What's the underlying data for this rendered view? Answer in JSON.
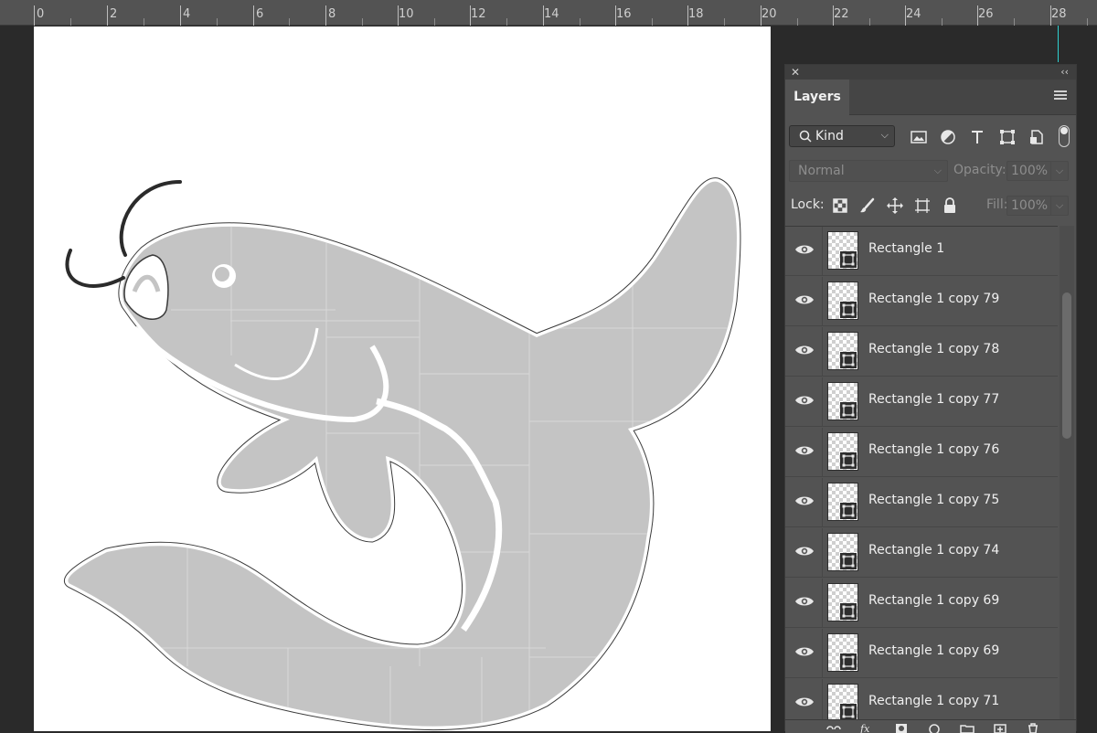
{
  "ruler": {
    "labels": [
      "0",
      "2",
      "4",
      "6",
      "8",
      "10",
      "12",
      "14",
      "16",
      "18",
      "20",
      "22",
      "24",
      "26",
      "28"
    ]
  },
  "layers_panel": {
    "tab_label": "Layers",
    "filter": {
      "kind_label": "Kind"
    },
    "blend_mode": "Normal",
    "opacity_label": "Opacity:",
    "opacity_value": "100%",
    "lock_label": "Lock:",
    "fill_label": "Fill:",
    "fill_value": "100%",
    "layers": [
      {
        "name": "Rectangle 1",
        "visible": true
      },
      {
        "name": "Rectangle 1 copy 79",
        "visible": true
      },
      {
        "name": "Rectangle 1 copy 78",
        "visible": true
      },
      {
        "name": "Rectangle 1 copy 77",
        "visible": true
      },
      {
        "name": "Rectangle 1 copy 76",
        "visible": true
      },
      {
        "name": "Rectangle 1 copy 75",
        "visible": true
      },
      {
        "name": "Rectangle 1 copy 74",
        "visible": true
      },
      {
        "name": "Rectangle 1 copy 69",
        "visible": true
      },
      {
        "name": "Rectangle 1 copy 69",
        "visible": true
      },
      {
        "name": "Rectangle 1 copy 71",
        "visible": true
      }
    ]
  },
  "colors": {
    "panel_bg": "#535353",
    "workspace_bg": "#2a2a2a",
    "guide": "#2fd0d0",
    "fish_fill": "#c4c4c4",
    "whisker": "#2b2b2b"
  }
}
